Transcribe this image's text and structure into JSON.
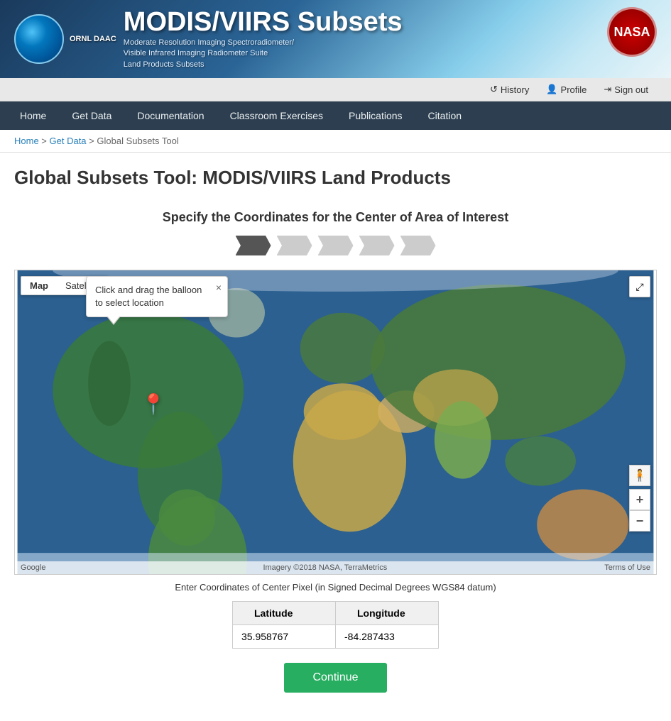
{
  "site": {
    "title": "MODIS/VIIRS Subsets",
    "subtitle_line1": "Moderate Resolution Imaging Spectroradiometer/",
    "subtitle_line2": "Visible Infrared Imaging Radiometer Suite",
    "subtitle_line3": "Land Products Subsets",
    "ornl_label": "ORNL DAAC"
  },
  "top_nav": {
    "history_label": "History",
    "profile_label": "Profile",
    "signout_label": "Sign out"
  },
  "main_nav": {
    "items": [
      {
        "id": "home",
        "label": "Home"
      },
      {
        "id": "get-data",
        "label": "Get Data"
      },
      {
        "id": "documentation",
        "label": "Documentation"
      },
      {
        "id": "classroom",
        "label": "Classroom Exercises"
      },
      {
        "id": "publications",
        "label": "Publications"
      },
      {
        "id": "citation",
        "label": "Citation"
      }
    ]
  },
  "breadcrumb": {
    "home": "Home",
    "get_data": "Get Data",
    "current": "Global Subsets Tool"
  },
  "page": {
    "title": "Global Subsets Tool: MODIS/VIIRS Land Products",
    "step_heading": "Specify the Coordinates for the Center of Area of Interest"
  },
  "steps": [
    {
      "id": 1,
      "active": true
    },
    {
      "id": 2,
      "active": false
    },
    {
      "id": 3,
      "active": false
    },
    {
      "id": 4,
      "active": false
    },
    {
      "id": 5,
      "active": false
    }
  ],
  "map": {
    "tab_map": "Map",
    "tab_satellite": "Satellite",
    "tooltip_text": "Click and drag the balloon to select location",
    "tooltip_close": "×",
    "fullscreen_icon": "⤢",
    "person_icon": "🧍",
    "zoom_in": "+",
    "zoom_out": "−",
    "google_label": "Google",
    "imagery_label": "Imagery ©2018 NASA, TerraMetrics",
    "terms_label": "Terms of Use"
  },
  "coordinates": {
    "label": "Enter Coordinates of Center Pixel (in Signed Decimal Degrees WGS84 datum)",
    "lat_header": "Latitude",
    "lon_header": "Longitude",
    "lat_value": "35.958767",
    "lon_value": "-84.287433"
  },
  "continue_button": "Continue"
}
